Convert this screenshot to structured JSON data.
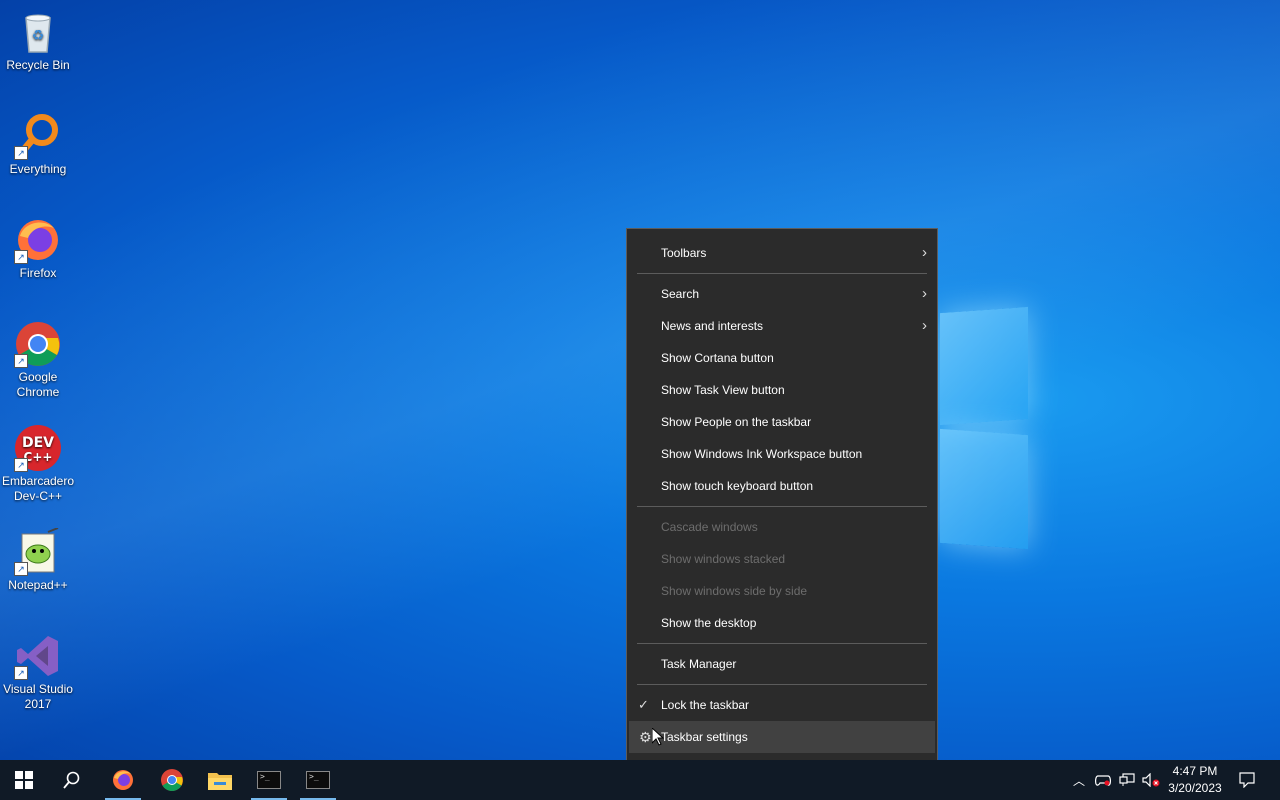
{
  "desktop_icons": [
    {
      "name": "Recycle Bin",
      "icon": "recycle-bin-icon"
    },
    {
      "name": "Everything",
      "icon": "everything-search-icon"
    },
    {
      "name": "Firefox",
      "icon": "firefox-icon"
    },
    {
      "name": "Google Chrome",
      "icon": "chrome-icon"
    },
    {
      "name": "Embarcadero Dev-C++",
      "icon": "devcpp-icon"
    },
    {
      "name": "Notepad++",
      "icon": "notepadpp-icon"
    },
    {
      "name": "Visual Studio 2017",
      "icon": "visual-studio-icon"
    }
  ],
  "devcpp_logo_text": "DEV C++",
  "context_menu": {
    "toolbars": "Toolbars",
    "search": "Search",
    "news": "News and interests",
    "cortana": "Show Cortana button",
    "task_view": "Show Task View button",
    "people": "Show People on the taskbar",
    "ink": "Show Windows Ink Workspace button",
    "touch_keyboard": "Show touch keyboard button",
    "cascade": "Cascade windows",
    "stacked": "Show windows stacked",
    "side_by_side": "Show windows side by side",
    "show_desktop": "Show the desktop",
    "task_manager": "Task Manager",
    "lock_taskbar": "Lock the taskbar",
    "taskbar_settings": "Taskbar settings"
  },
  "taskbar": {
    "time": "4:47 PM",
    "date": "3/20/2023",
    "apps": [
      "start-icon",
      "search-icon",
      "firefox-icon",
      "chrome-icon",
      "file-explorer-icon",
      "terminal-icon",
      "terminal-icon"
    ]
  },
  "colors": {
    "menu_bg": "#2b2b2b",
    "taskbar_bg": "#101a26",
    "accent": "#76b9ed"
  }
}
